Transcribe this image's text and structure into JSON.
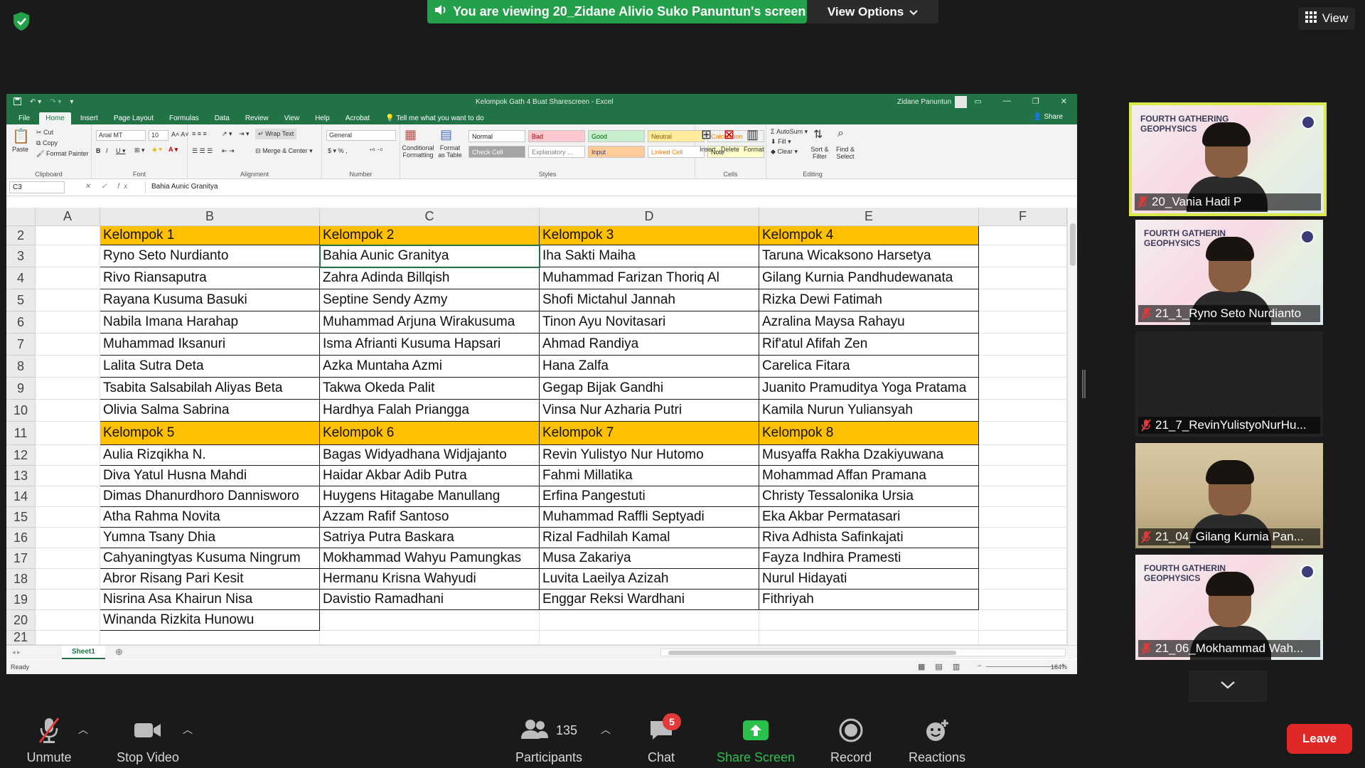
{
  "zoom": {
    "banner_text": "You are viewing 20_Zidane Alivio Suko Panuntun's screen",
    "view_options": "View Options",
    "view_label": "View",
    "participants_count": "135",
    "chat_badge": "5",
    "bottom": {
      "unmute": "Unmute",
      "stop_video": "Stop Video",
      "participants": "Participants",
      "chat": "Chat",
      "share_screen": "Share Screen",
      "record": "Record",
      "reactions": "Reactions",
      "leave": "Leave"
    },
    "colors": {
      "banner_green": "#23a04a",
      "share_green": "#29c04b",
      "leave_red": "#e02828",
      "active_speaker": "#d9e84a"
    },
    "tiles": [
      {
        "name": "20_Vania Hadi P",
        "type": "slide",
        "slide_text": "FOURTH GATHERING\nGEOPHYSICS",
        "active": true
      },
      {
        "name": "21_1_Ryno Seto Nurdianto",
        "type": "slide",
        "slide_text": "FOURTH GATHERIN\nGEOPHYSICS"
      },
      {
        "name": "21_7_RevinYulistyoNurHu...",
        "type": "blank"
      },
      {
        "name": "21_04_Gilang Kurnia Pan...",
        "type": "camera"
      },
      {
        "name": "21_06_Mokhammad Wah...",
        "type": "slide",
        "slide_text": "FOURTH GATHERIN\nGEOPHYSICS"
      }
    ]
  },
  "excel": {
    "doc_title": "Kelompok Gath 4 Buat Sharescreen  -  Excel",
    "user": "Zidane Panuntun",
    "tabs": [
      "File",
      "Home",
      "Insert",
      "Page Layout",
      "Formulas",
      "Data",
      "Review",
      "View",
      "Help",
      "Acrobat"
    ],
    "tell_me": "Tell me what you want to do",
    "share": "Share",
    "ribbon": {
      "clipboard": {
        "paste": "Paste",
        "cut": "Cut",
        "copy": "Copy",
        "format_painter": "Format Painter",
        "name": "Clipboard"
      },
      "font": {
        "family": "Arial MT",
        "size": "10",
        "name": "Font"
      },
      "alignment": {
        "wrap_text": "Wrap Text",
        "merge_center": "Merge & Center",
        "name": "Alignment"
      },
      "number": {
        "format": "General",
        "name": "Number"
      },
      "styles": {
        "conditional": "Conditional Formatting",
        "format_as_table": "Format as Table",
        "cells": [
          {
            "label": "Normal",
            "bg": "#ffffff",
            "fg": "#222222"
          },
          {
            "label": "Bad",
            "bg": "#ffc7ce",
            "fg": "#9c0006"
          },
          {
            "label": "Good",
            "bg": "#c6efce",
            "fg": "#006100"
          },
          {
            "label": "Neutral",
            "bg": "#ffeb9c",
            "fg": "#9c5700"
          },
          {
            "label": "Calculation",
            "bg": "#f2f2f2",
            "fg": "#fa7d00"
          },
          {
            "label": "Check Cell",
            "bg": "#a5a5a5",
            "fg": "#ffffff"
          },
          {
            "label": "Explanatory ...",
            "bg": "#ffffff",
            "fg": "#7f7f7f"
          },
          {
            "label": "Input",
            "bg": "#ffcc99",
            "fg": "#3f3f76"
          },
          {
            "label": "Linked Cell",
            "bg": "#ffffff",
            "fg": "#fa7d00"
          },
          {
            "label": "Note",
            "bg": "#ffffcc",
            "fg": "#222222"
          }
        ],
        "name": "Styles"
      },
      "cells": {
        "insert": "Insert",
        "delete": "Delete",
        "format": "Format",
        "name": "Cells"
      },
      "editing": {
        "autosum": "AutoSum",
        "fill": "Fill",
        "clear": "Clear",
        "sort_filter": "Sort & Filter",
        "find_select": "Find & Select",
        "name": "Editing"
      }
    },
    "name_box": "C3",
    "formula_content": "Bahia Aunic Granitya",
    "columns": [
      "A",
      "B",
      "C",
      "D",
      "E",
      "F"
    ],
    "rows": [
      "2",
      "3",
      "4",
      "5",
      "6",
      "7",
      "8",
      "9",
      "10",
      "11",
      "12",
      "13",
      "14",
      "15",
      "16",
      "17",
      "18",
      "19",
      "20",
      "21"
    ],
    "table1_headers": [
      "Kelompok 1",
      "Kelompok 2",
      "Kelompok 3",
      "Kelompok 4"
    ],
    "table1_rows": [
      [
        "Ryno Seto Nurdianto",
        "Bahia Aunic Granitya",
        "Iha Sakti Maiha",
        "Taruna Wicaksono Harsetya"
      ],
      [
        "Rivo Riansaputra",
        "Zahra Adinda Billqish",
        "Muhammad Farizan Thoriq Al",
        "Gilang Kurnia Pandhudewanata"
      ],
      [
        "Rayana Kusuma Basuki",
        "Septine Sendy Azmy",
        "Shofi Mictahul Jannah",
        "Rizka Dewi Fatimah"
      ],
      [
        "Nabila Imana Harahap",
        "Muhammad Arjuna Wirakusuma",
        "Tinon Ayu Novitasari",
        "Azralina Maysa Rahayu"
      ],
      [
        "Muhammad Iksanuri",
        "Isma Afrianti Kusuma Hapsari",
        "Ahmad Randiya",
        "Rif'atul Afifah Zen"
      ],
      [
        "Lalita Sutra Deta",
        "Azka Muntaha Azmi",
        "Hana Zalfa",
        "Carelica Fitara"
      ],
      [
        "Tsabita Salsabilah Aliyas Beta",
        "Takwa Okeda Palit",
        "Gegap Bijak Gandhi",
        "Juanito Pramuditya Yoga Pratama"
      ],
      [
        "Olivia Salma Sabrina",
        "Hardhya Falah Priangga",
        "Vinsa Nur Azharia Putri",
        "Kamila Nurun Yuliansyah"
      ]
    ],
    "table2_headers": [
      "Kelompok 5",
      "Kelompok 6",
      "Kelompok 7",
      "Kelompok 8"
    ],
    "table2_rows": [
      [
        "Aulia Rizqikha N.",
        "Bagas Widyadhana Widjajanto",
        "Revin Yulistyo Nur Hutomo",
        "Musyaffa Rakha Dzakiyuwana"
      ],
      [
        "Diva Yatul Husna Mahdi",
        "Haidar Akbar Adib Putra",
        "Fahmi Millatika",
        "Mohammad Affan Pramana"
      ],
      [
        "Dimas Dhanurdhoro Dannisworo",
        "Huygens Hitagabe Manullang",
        "Erfina Pangestuti",
        "Christy Tessalonika Ursia"
      ],
      [
        "Atha Rahma Novita",
        "Azzam Rafif Santoso",
        "Muhammad Raffli Septyadi",
        "Eka Akbar Permatasari"
      ],
      [
        "Yumna Tsany Dhia",
        "Satriya Putra Baskara",
        "Rizal Fadhilah Kamal",
        "Riva Adhista Safinkajati"
      ],
      [
        "Cahyaningtyas Kusuma Ningrum",
        "Mokhammad Wahyu Pamungkas",
        "Musa Zakariya",
        "Fayza Indhira Pramesti"
      ],
      [
        "Abror Risang Pari Kesit",
        "Hermanu Krisna Wahyudi",
        "Luvita Laeilya Azizah",
        "Nurul Hidayati"
      ],
      [
        "Nisrina Asa Khairun Nisa",
        "Davistio Ramadhani",
        "Enggar Reksi Wardhani",
        "Fithriyah"
      ],
      [
        "Winanda Rizkita Hunowu",
        "",
        "",
        ""
      ]
    ],
    "group_color": "#ffc000",
    "sheet_tab": "Sheet1",
    "status": "Ready",
    "zoom_level": "184%"
  }
}
